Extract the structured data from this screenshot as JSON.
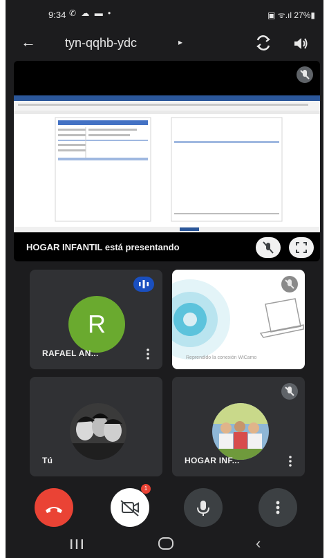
{
  "status_bar": {
    "time": "9:34",
    "left_icons": "✆ ☁ ▬ •",
    "right_text": "▣ ᯤ.ıl 27%▮"
  },
  "header": {
    "meeting_code": "tyn-qqhb-ydc",
    "arrow": "▸",
    "back_glyph": "←"
  },
  "presentation": {
    "caption": "HOGAR INFANTIL está presentando"
  },
  "tiles": [
    {
      "name": "RAFAEL AN...",
      "avatar_letter": "R",
      "avatar_color": "#6aaa2f"
    },
    {
      "status_text": "Reprendido la conexión WiCamo"
    },
    {
      "name": "Tú"
    },
    {
      "name": "HOGAR INF..."
    }
  ],
  "controls": {
    "camera_badge": "1"
  },
  "colors": {
    "end_call": "#ea4335",
    "speaking_badge": "#1a4fbf",
    "background": "#1c1c1e"
  }
}
